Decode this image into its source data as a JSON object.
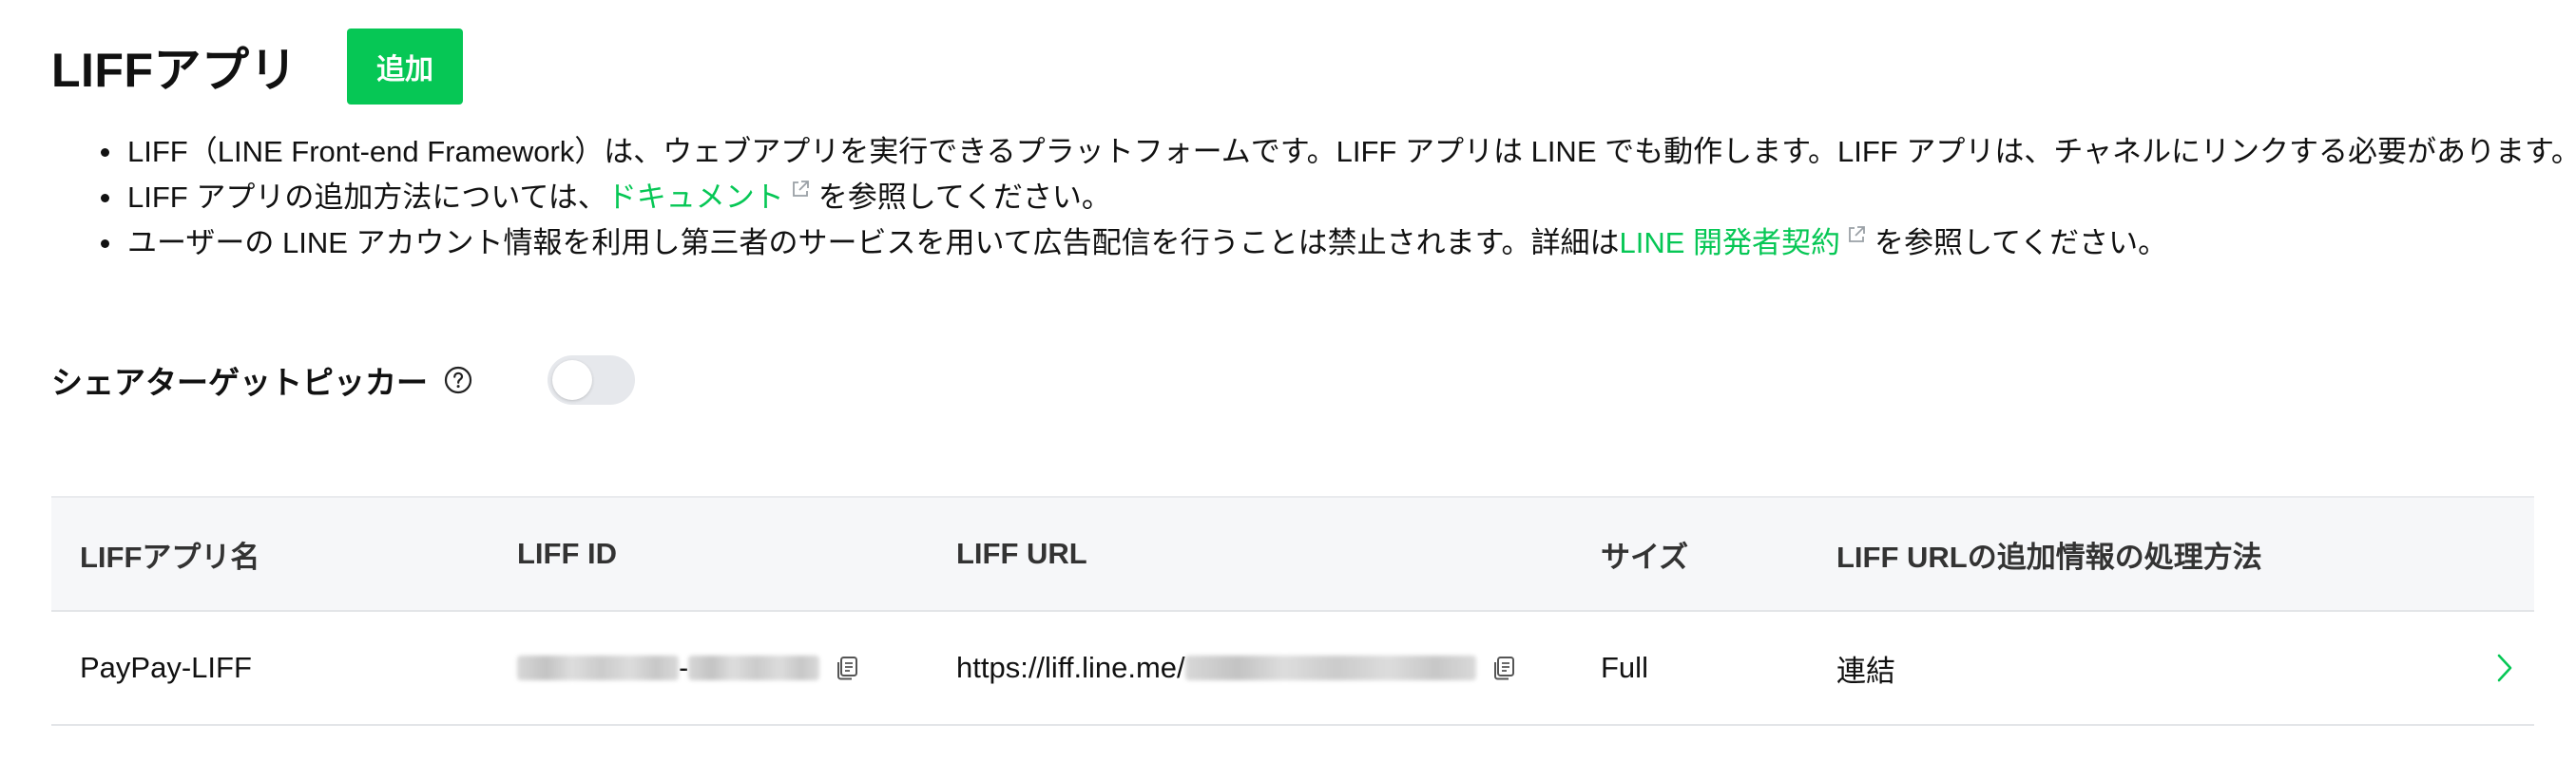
{
  "header": {
    "title": "LIFFアプリ",
    "add_button": "追加"
  },
  "notes": {
    "item1": "LIFF（LINE Front-end Framework）は、ウェブアプリを実行できるプラットフォームです。LIFF アプリは LINE でも動作します。LIFF アプリは、チャネルにリンクする必要があります。",
    "item2_before": "LIFF アプリの追加方法については、",
    "item2_link": "ドキュメント",
    "item2_after": "を参照してください。",
    "item3_before": "ユーザーの LINE アカウント情報を利用し第三者のサービスを用いて広告配信を行うことは禁止されます。詳細は",
    "item3_link": "LINE 開発者契約",
    "item3_after": "を参照してください。"
  },
  "share_target_picker": {
    "label": "シェアターゲットピッカー",
    "enabled": false
  },
  "table": {
    "headers": [
      "LIFFアプリ名",
      "LIFF ID",
      "LIFF URL",
      "サイズ",
      "LIFF URLの追加情報の処理方法"
    ],
    "rows": [
      {
        "name": "PayPay-LIFF",
        "liff_id_separator": "-",
        "liff_url_prefix": "https://liff.line.me/",
        "size": "Full",
        "handling": "連結"
      }
    ]
  },
  "icons": {
    "external_link": "external-link-icon",
    "help": "help-icon",
    "copy": "copy-icon",
    "chevron": "chevron-right-icon"
  },
  "colors": {
    "brand_green": "#06c755",
    "toggle_off": "#e6e8ec",
    "table_header_bg": "#f6f7f9"
  }
}
